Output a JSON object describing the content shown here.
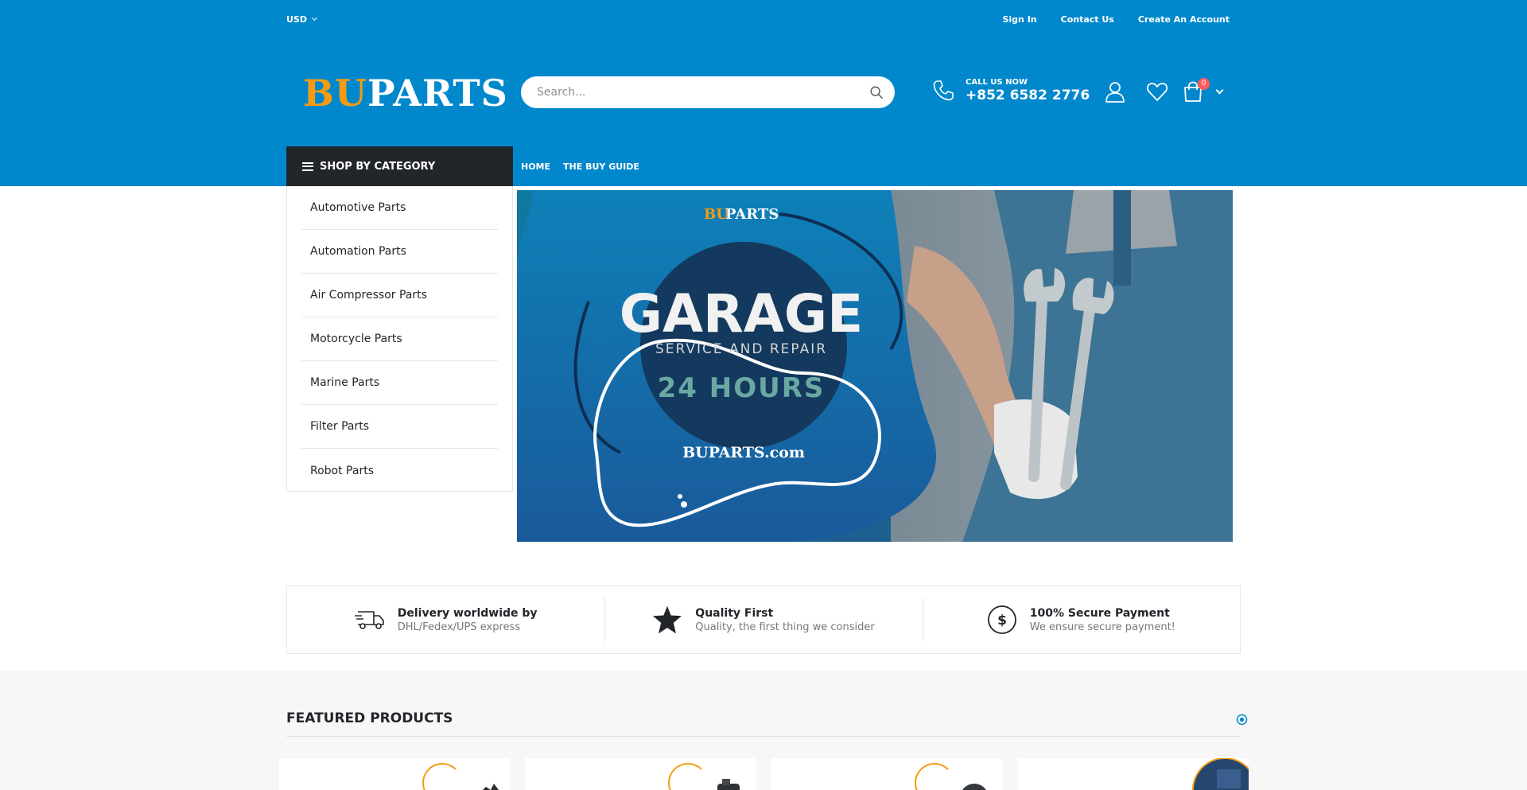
{
  "topbar": {
    "currency": "USD",
    "links": [
      "Sign In",
      "Contact Us",
      "Create An Account"
    ]
  },
  "header": {
    "logo_bu": "BU",
    "logo_parts": "PARTS",
    "search_placeholder": "Search...",
    "call_label": "CALL US NOW",
    "phone": "+852 6582 2776",
    "cart_count": "0"
  },
  "nav": {
    "shop_by_category": "SHOP BY CATEGORY",
    "links": [
      "HOME",
      "THE BUY GUIDE"
    ]
  },
  "categories": [
    "Automotive Parts",
    "Automation Parts",
    "Air Compressor Parts",
    "Motorcycle Parts",
    "Marine Parts",
    "Filter Parts",
    "Robot Parts"
  ],
  "banner": {
    "brand_bu": "BU",
    "brand_parts": "PARTS",
    "headline": "GARAGE",
    "subline": "SERVICE AND REPAIR",
    "hours": "24 HOURS",
    "site": "BUPARTS.com"
  },
  "features": [
    {
      "title": "Delivery worldwide by",
      "subtitle": "DHL/Fedex/UPS express",
      "icon": "truck-icon"
    },
    {
      "title": "Quality First",
      "subtitle": "Quality, the first thing we consider",
      "icon": "star-icon"
    },
    {
      "title": "100% Secure Payment",
      "subtitle": "We ensure secure payment!",
      "icon": "dollar-icon"
    }
  ],
  "featured": {
    "title": "FEATURED PRODUCTS"
  },
  "colors": {
    "brand_blue": "#0188cc",
    "dark": "#222529",
    "accent_orange": "#f59b13",
    "badge_red": "#ff5b5b"
  }
}
